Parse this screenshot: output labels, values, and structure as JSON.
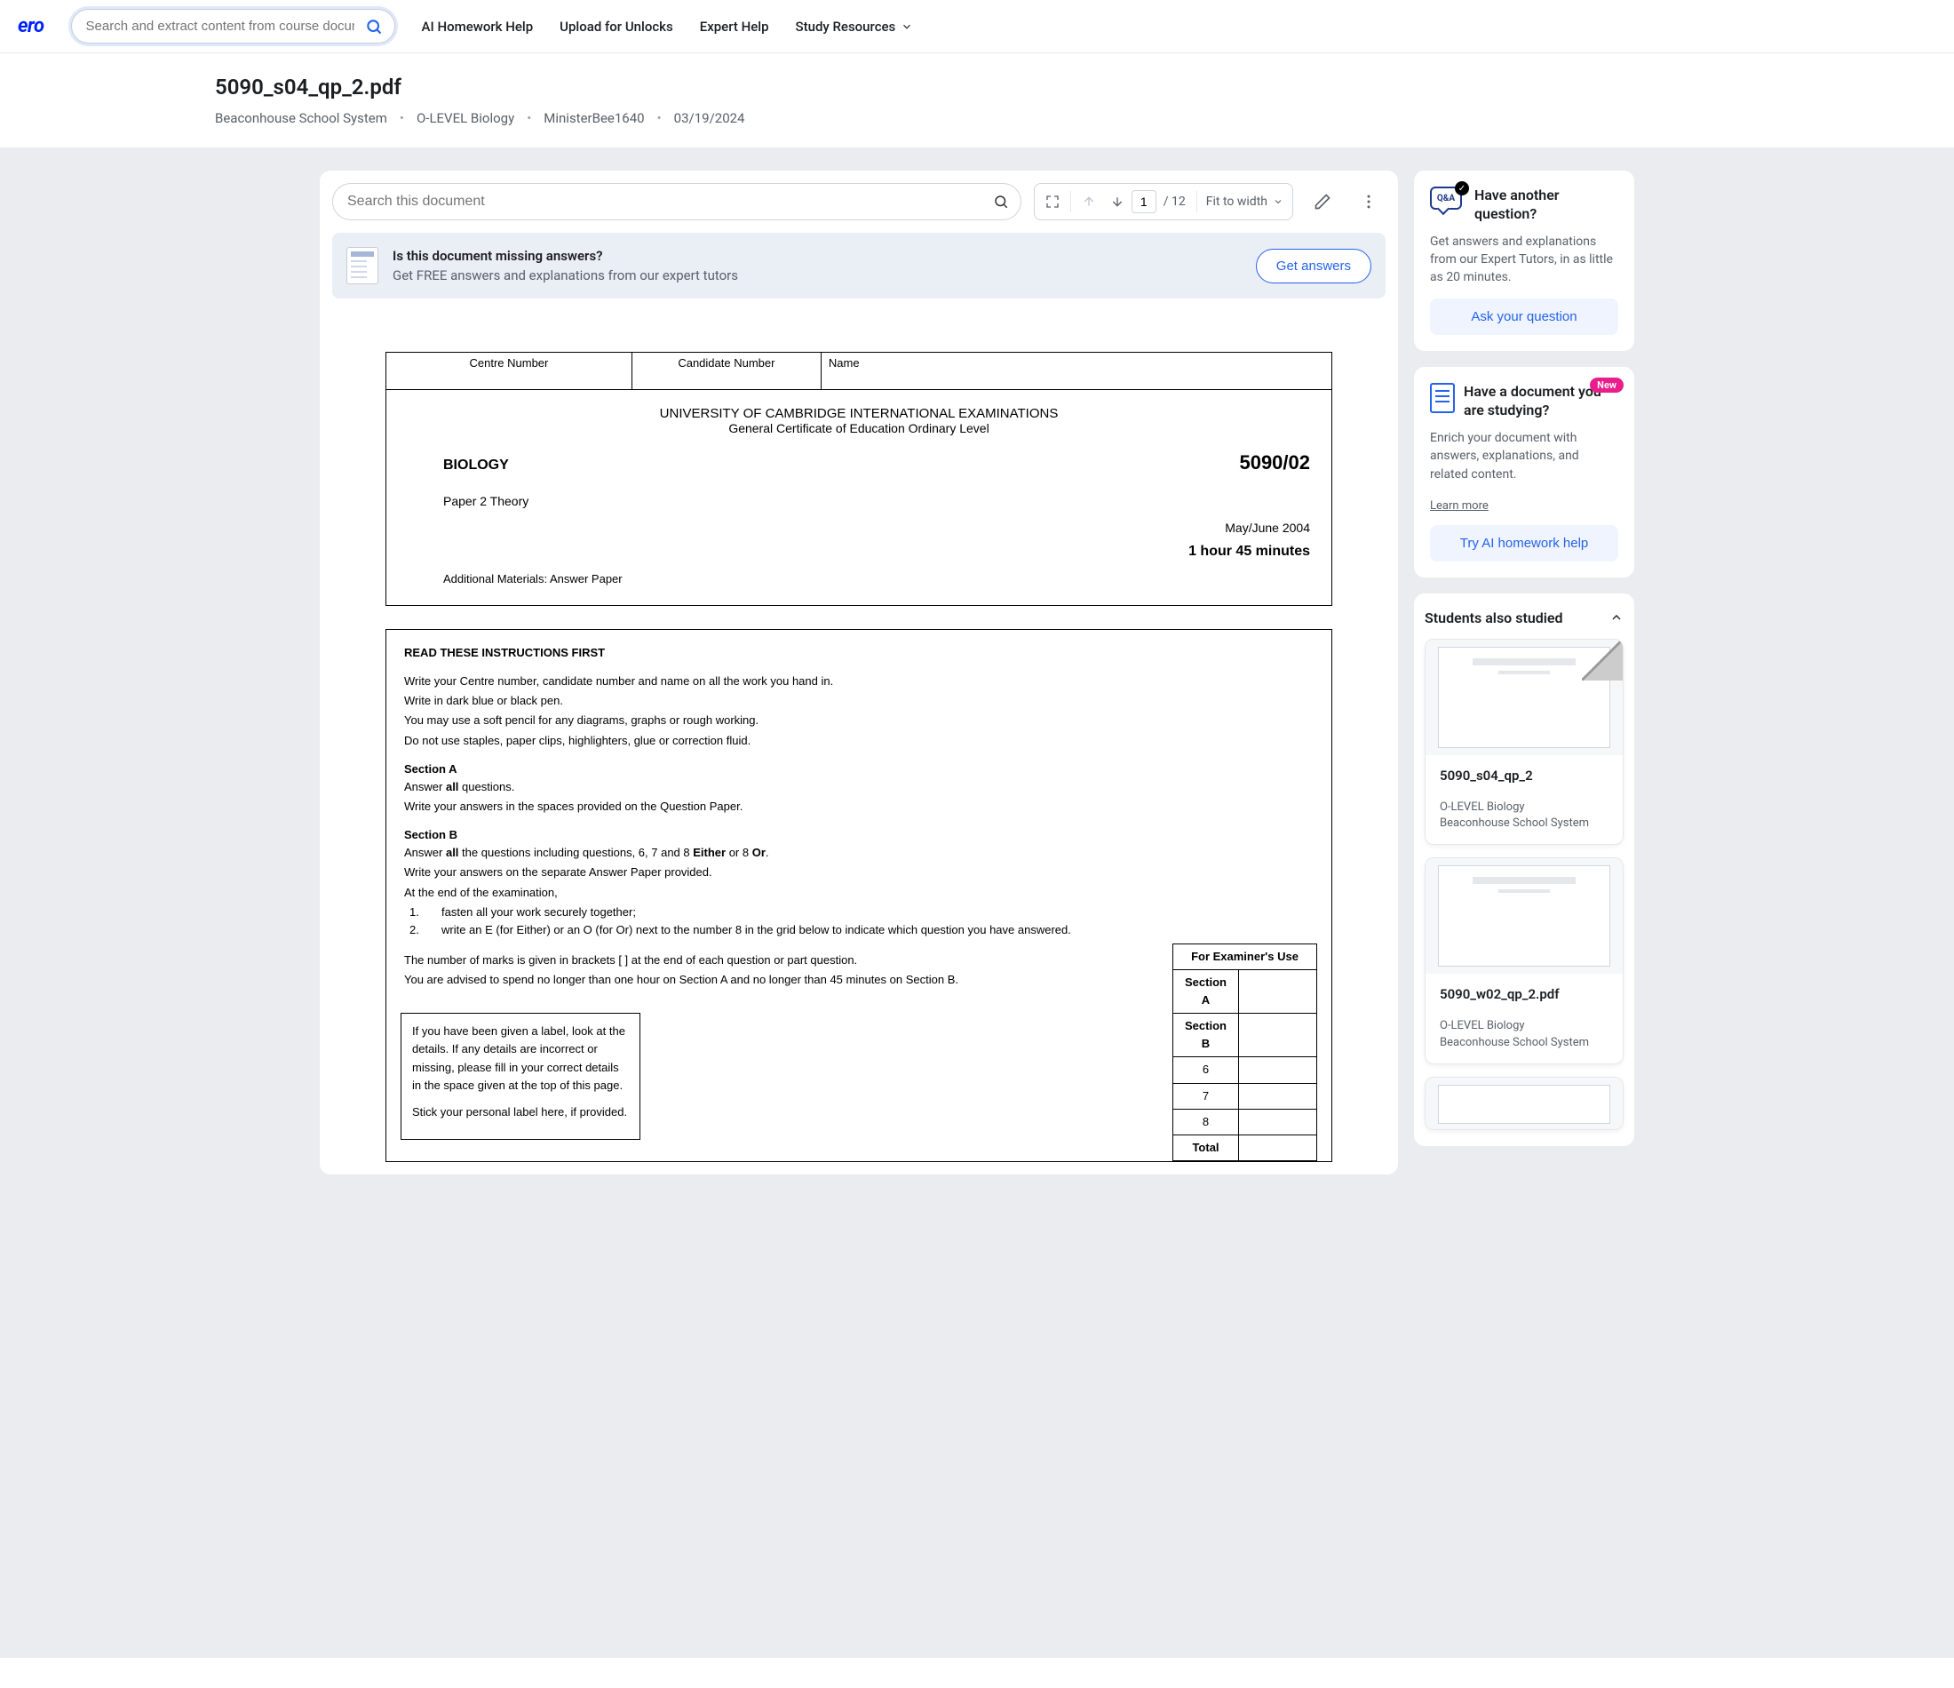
{
  "nav": {
    "logo": "ero",
    "search_placeholder": "Search and extract content from course documents,",
    "links": [
      "AI Homework Help",
      "Upload for Unlocks",
      "Expert Help",
      "Study Resources"
    ]
  },
  "header": {
    "title": "5090_s04_qp_2.pdf",
    "breadcrumb": [
      "Beaconhouse School System",
      "O-LEVEL Biology",
      "MinisterBee1640",
      "03/19/2024"
    ]
  },
  "toolbar": {
    "search_placeholder": "Search this document",
    "page_current": "1",
    "page_total": "/ 12",
    "zoom": "Fit to width"
  },
  "answers_banner": {
    "title": "Is this document missing answers?",
    "subtitle": "Get FREE answers and explanations from our expert tutors",
    "button": "Get answers"
  },
  "document": {
    "header_cells": [
      "Centre Number",
      "Candidate Number",
      "Name"
    ],
    "uni": "UNIVERSITY OF CAMBRIDGE INTERNATIONAL EXAMINATIONS",
    "gce": "General Certificate of Education Ordinary Level",
    "subject": "BIOLOGY",
    "code": "5090/02",
    "paper": "Paper 2  Theory",
    "date": "May/June 2004",
    "duration": "1 hour 45 minutes",
    "materials": "Additional Materials:    Answer Paper",
    "instr_title": "READ THESE INSTRUCTIONS FIRST",
    "instr_lines": [
      "Write your Centre number, candidate number and name on all the work you hand in.",
      "Write in dark blue or black pen.",
      "You may use a soft pencil for any diagrams, graphs or rough working.",
      "Do not use staples, paper clips, highlighters, glue or correction fluid."
    ],
    "sectionA_parts": [
      "Answer ",
      "all",
      " questions."
    ],
    "sectionA_line2": "Write your answers in the spaces provided on the Question Paper.",
    "sectionB_parts": [
      "Answer ",
      "all",
      " the questions including questions, 6, 7 and 8 ",
      "Either",
      " or 8 ",
      "Or",
      "."
    ],
    "sectionB_line2": "Write your answers on the separate Answer Paper provided.",
    "sectionB_line3": "At the end of the examination,",
    "sectionB_li1": "fasten all your work securely together;",
    "sectionB_li2": "write an E (for Either) or an O (for Or) next to the number 8 in the grid below to indicate which question you have answered.",
    "marks_line": "The number of marks is given in brackets [  ] at the end of each question or part question.",
    "advise_line": "You are advised to spend no longer than one hour on Section A and no longer than 45 minutes on Section B.",
    "label_box_1": "If you have been given a label, look at the details. If any details are incorrect or missing, please fill in your correct details in the space given at the top of this page.",
    "label_box_2": "Stick your personal label here, if provided.",
    "ex_table_header": "For Examiner's Use",
    "ex_rows": [
      "Section A",
      "Section B",
      "6",
      "7",
      "8",
      "Total"
    ]
  },
  "sidebar": {
    "qa_title": "Have another question?",
    "qa_desc": "Get answers and explanations from our Expert Tutors, in as little as 20 minutes.",
    "qa_btn": "Ask your question",
    "study_new": "New",
    "study_title": "Have a document you are studying?",
    "study_desc": "Enrich your document with answers, explanations, and related content.",
    "study_learn": "Learn more",
    "study_btn": "Try AI homework help",
    "sas_title": "Students also studied",
    "related": [
      {
        "title": "5090_s04_qp_2",
        "meta1": "O-LEVEL Biology",
        "meta2": "Beaconhouse School System"
      },
      {
        "title": "5090_w02_qp_2.pdf",
        "meta1": "O-LEVEL Biology",
        "meta2": "Beaconhouse School System"
      }
    ]
  },
  "labels": {
    "sectionA": "Section A",
    "sectionB": "Section B"
  }
}
